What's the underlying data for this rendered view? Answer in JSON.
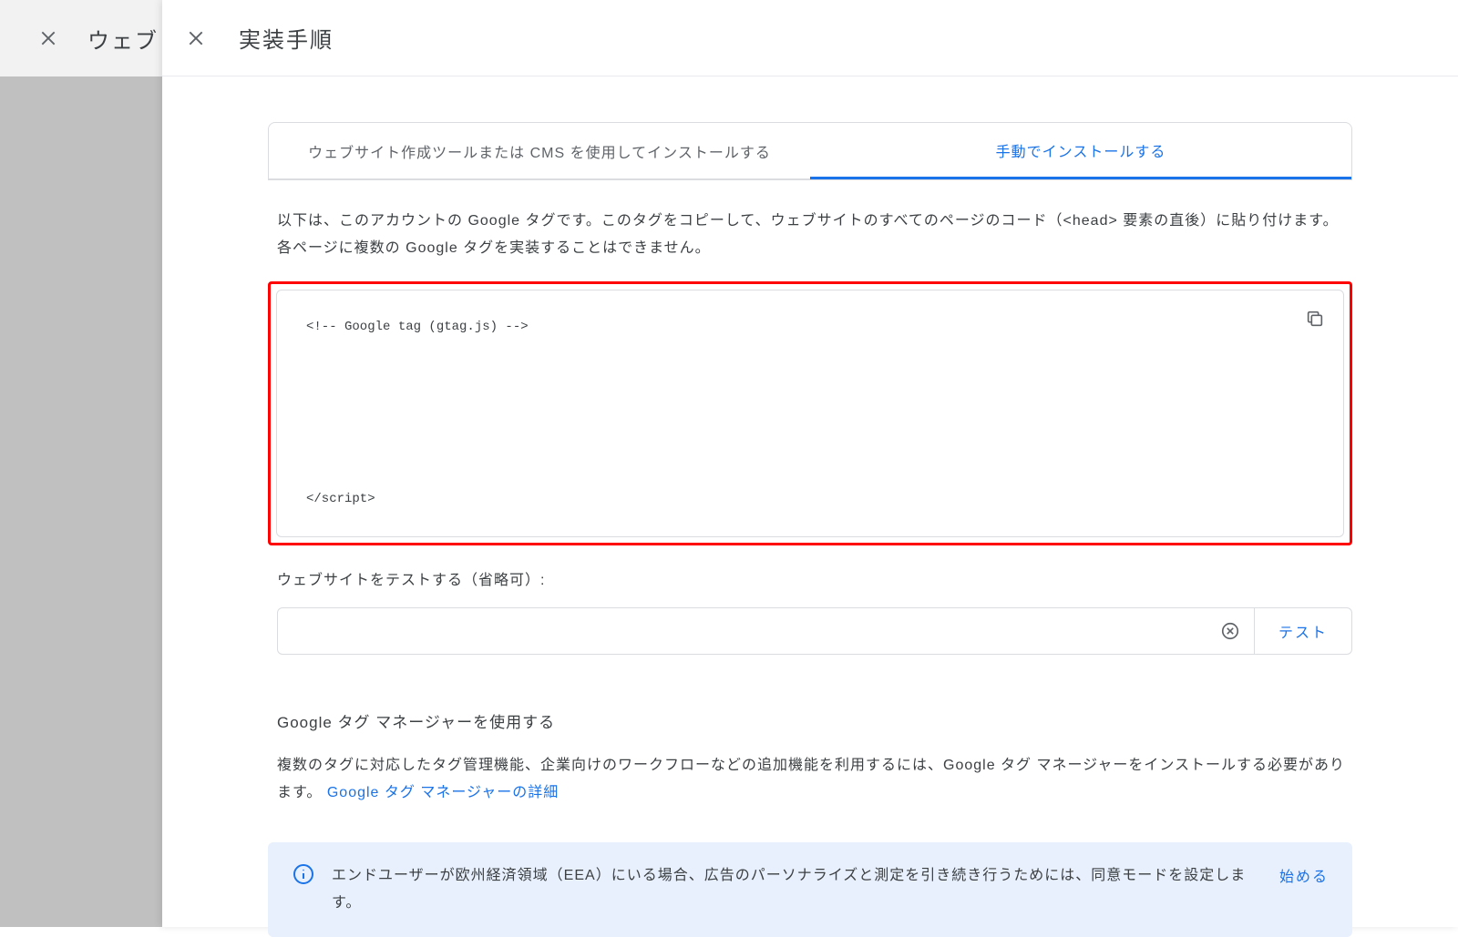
{
  "background": {
    "title": "ウェブ"
  },
  "panel": {
    "title": "実装手順"
  },
  "tabs": {
    "cms": "ウェブサイト作成ツールまたは CMS を使用してインストールする",
    "manual": "手動でインストールする"
  },
  "description": "以下は、このアカウントの Google タグです。このタグをコピーして、ウェブサイトのすべてのページのコード（<head> 要素の直後）に貼り付けます。各ページに複数の Google タグを実装することはできません。",
  "code": {
    "line1": "<!-- Google tag (gtag.js) -->",
    "line2": "</script>"
  },
  "test": {
    "label": "ウェブサイトをテストする（省略可）:",
    "button": "テスト"
  },
  "gtm": {
    "heading": "Google タグ マネージャーを使用する",
    "desc_before": "複数のタグに対応したタグ管理機能、企業向けのワークフローなどの追加機能を利用するには、Google タグ マネージャーをインストールする必要があります。",
    "link": "Google タグ マネージャーの詳細"
  },
  "banner": {
    "text": "エンドユーザーが欧州経済領域（EEA）にいる場合、広告のパーソナライズと測定を引き続き行うためには、同意モードを設定します。",
    "action": "始める"
  }
}
